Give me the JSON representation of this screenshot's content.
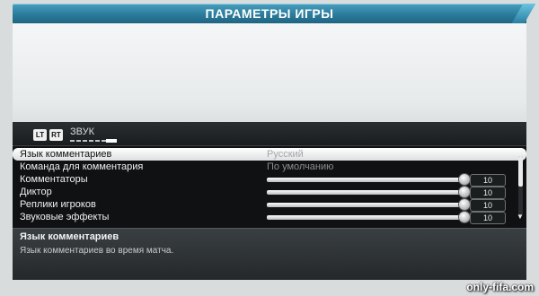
{
  "header": {
    "title": "ПАРАМЕТРЫ ИГРЫ"
  },
  "tabs": {
    "lt_button": "LT",
    "rt_button": "RT",
    "active_tab": "ЗВУК"
  },
  "settings": [
    {
      "label": "Язык комментариев",
      "value": "Русский",
      "kind": "select",
      "selected": true
    },
    {
      "label": "Команда для комментария",
      "value": "По умолчанию",
      "kind": "select",
      "selected": false
    },
    {
      "label": "Комментаторы",
      "value": "10",
      "kind": "slider",
      "level": 1.0,
      "selected": false
    },
    {
      "label": "Диктор",
      "value": "10",
      "kind": "slider",
      "level": 1.0,
      "selected": false
    },
    {
      "label": "Реплики игроков",
      "value": "10",
      "kind": "slider",
      "level": 1.0,
      "selected": false
    },
    {
      "label": "Звуковые эффекты",
      "value": "10",
      "kind": "slider",
      "level": 1.0,
      "selected": false
    }
  ],
  "description": {
    "title": "Язык комментариев",
    "text": "Язык комментариев во время матча."
  },
  "watermark": "only-fifa.com",
  "colors": {
    "header_blue": "#2b7c9c",
    "panel_dark": "#0f1112",
    "selection": "#ffffff"
  }
}
